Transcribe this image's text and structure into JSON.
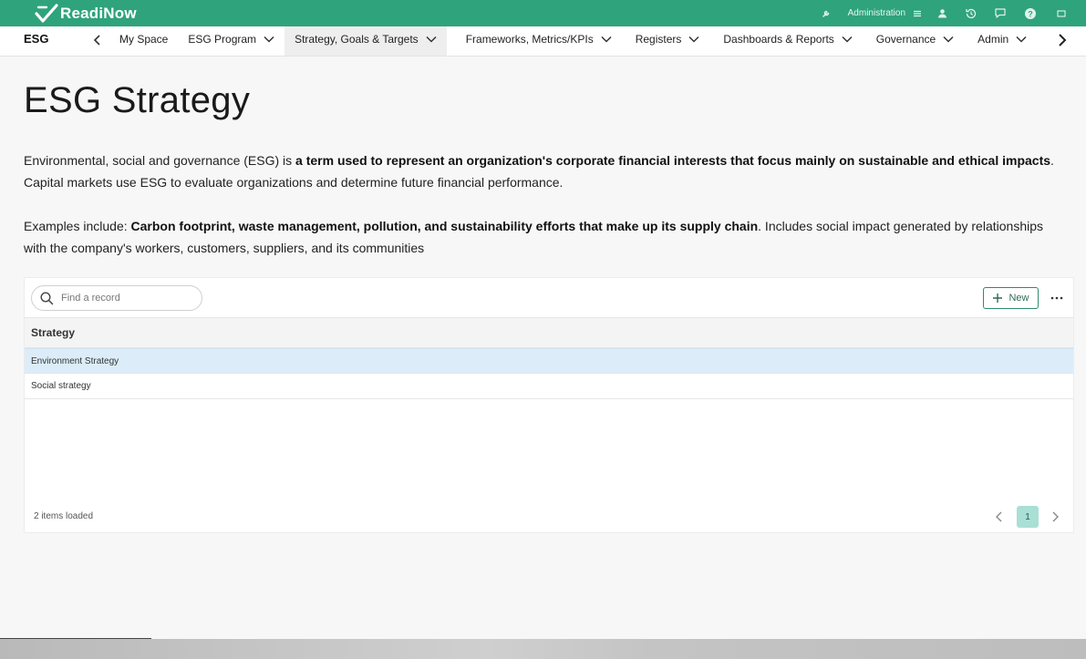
{
  "app": {
    "brand": "ReadiNow",
    "admin_label": "Administration"
  },
  "navbar": {
    "app_name": "ESG",
    "items": [
      {
        "label": "My Space",
        "has_menu": false
      },
      {
        "label": "ESG Program",
        "has_menu": true
      },
      {
        "label": "Strategy, Goals & Targets",
        "has_menu": true,
        "active": true
      },
      {
        "label": "Frameworks, Metrics/KPIs",
        "has_menu": true
      },
      {
        "label": "Registers",
        "has_menu": true
      },
      {
        "label": "Dashboards & Reports",
        "has_menu": true
      },
      {
        "label": "Governance",
        "has_menu": true
      },
      {
        "label": "Admin",
        "has_menu": true
      }
    ]
  },
  "page": {
    "title": "ESG Strategy",
    "p1_text_a": "Environmental, social and governance (ESG) is ",
    "p1_bold": "a term used to represent an organization's corporate financial interests that focus mainly on sustainable and ethical impacts",
    "p1_text_b": ". Capital markets use ESG to evaluate organizations and determine future financial performance.",
    "p2_text_a": "Examples include: ",
    "p2_bold": "Carbon footprint, waste management, pollution, and sustainability efforts that make up its supply chain",
    "p2_text_b": ". Includes social impact generated by relationships with the company's workers, customers, suppliers, and its communities"
  },
  "grid": {
    "search_placeholder": "Find a record",
    "new_label": "New",
    "column_header": "Strategy",
    "rows": [
      {
        "label": "Environment Strategy",
        "selected": true
      },
      {
        "label": "Social strategy",
        "selected": false
      }
    ],
    "status": "2 items loaded",
    "current_page": "1"
  },
  "colors": {
    "topbar": "#2fa37c",
    "accent": "#2d8c6d",
    "selected_row": "#dcedf9",
    "page_badge": "#a9dfd5"
  },
  "icons": [
    "readinow-logo-icon",
    "wrench-icon",
    "menu-icon",
    "user-icon",
    "history-icon",
    "chat-icon",
    "help-icon",
    "fullscreen-icon",
    "chevron-left-icon",
    "chevron-right-icon",
    "chevron-down-icon",
    "search-icon",
    "plus-icon",
    "more-icon"
  ]
}
